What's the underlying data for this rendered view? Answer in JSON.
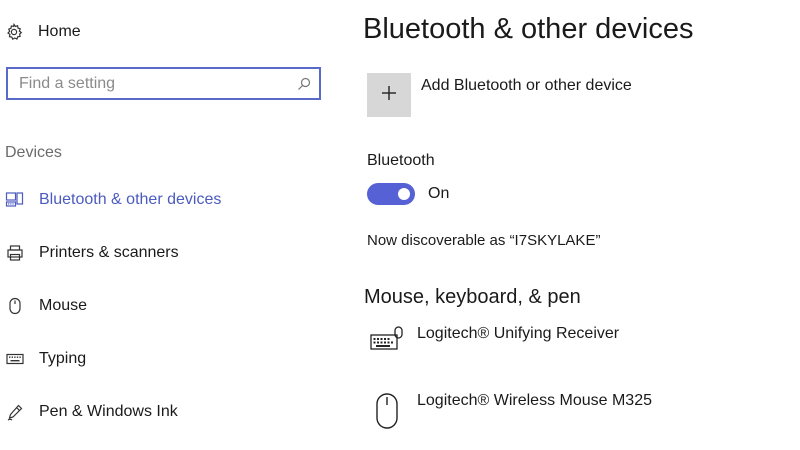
{
  "sidebar": {
    "home_label": "Home",
    "search_placeholder": "Find a setting",
    "section_label": "Devices",
    "items": [
      {
        "label": "Bluetooth & other devices",
        "icon": "bluetooth-devices-icon",
        "active": true
      },
      {
        "label": "Printers & scanners",
        "icon": "printer-icon",
        "active": false
      },
      {
        "label": "Mouse",
        "icon": "mouse-icon",
        "active": false
      },
      {
        "label": "Typing",
        "icon": "keyboard-icon",
        "active": false
      },
      {
        "label": "Pen & Windows Ink",
        "icon": "pen-icon",
        "active": false
      }
    ]
  },
  "main": {
    "title": "Bluetooth & other devices",
    "add_device_label": "Add Bluetooth or other device",
    "bluetooth_label": "Bluetooth",
    "bluetooth_state": "On",
    "bluetooth_on": true,
    "discoverable_text": "Now discoverable as “I7SKYLAKE”",
    "section_title": "Mouse, keyboard, & pen",
    "devices": [
      {
        "label": "Logitech® Unifying Receiver",
        "icon": "keyboard-mouse-icon"
      },
      {
        "label": "Logitech® Wireless Mouse M325",
        "icon": "mouse-icon"
      }
    ]
  },
  "colors": {
    "accent": "#4b5bbf",
    "toggle_on": "#5561d4",
    "search_border": "#5a6ac9",
    "tile_bg": "#d7d7d7",
    "section_gray": "#6b6b6b"
  }
}
